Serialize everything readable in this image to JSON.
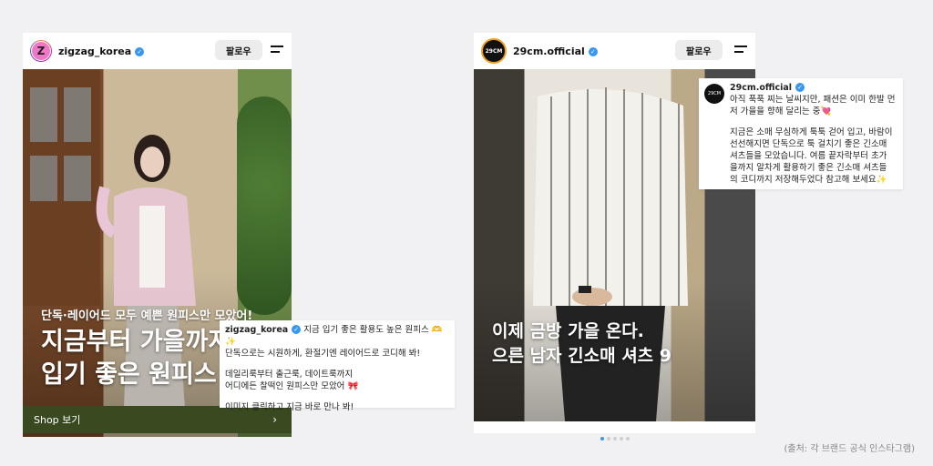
{
  "left_post": {
    "username": "zigzag_korea",
    "avatar_letter": "Z",
    "follow_label": "팔로우",
    "overlay_subtitle": "단독·레이어드 모두 예쁜 원피스만 모았어!",
    "overlay_title_line1": "지금부터 가을까지 쭉",
    "overlay_title_line2": "입기 좋은 원피스",
    "shop_label": "Shop 보기",
    "caption": {
      "username": "zigzag_korea",
      "line1": "지금 입기 좋은 활용도 높은 원피스 🫶 ✨",
      "line2": "단독으로는 시원하게, 환절기엔 레이어드로 코디해 봐!",
      "line3": "데일리룩부터 출근룩, 데이트룩까지",
      "line4": "어디에든 찰떡인 원피스만 모았어 🎀",
      "line5": "이미지 클릭하고 지금 바로 만나 봐!"
    }
  },
  "right_post": {
    "username": "29cm.official",
    "avatar_text": "29CM",
    "follow_label": "팔로우",
    "overlay_line1": "이제 금방 가을 온다.",
    "overlay_line2": "으른 남자 긴소매 셔츠 9",
    "caption": {
      "username": "29cm.official",
      "line1": "아직 푹푹 찌는 날씨지만, 패션은 이미 한발 먼",
      "line2": "저 가을을 향해 달리는 중💘",
      "line3": "지금은 소매 무심하게 툭툭 걷어 입고, 바람이",
      "line4": "선선해지면 단독으로 툭 걸치기 좋은 긴소매",
      "line5": "셔츠들을 모았습니다. 여름 끝자락부터 초가",
      "line6": "을까지 알차게 활용하기 좋은 긴소매 셔츠들",
      "line7": "의 코디까지 저장해두었다 참고해 보세요✨"
    }
  },
  "source_note": "(출처: 각 브랜드 공식 인스타그램)",
  "colors": {
    "verified": "#3897f0",
    "shop_bar": "#3a4a20",
    "page_bg": "#f1f1f3"
  }
}
